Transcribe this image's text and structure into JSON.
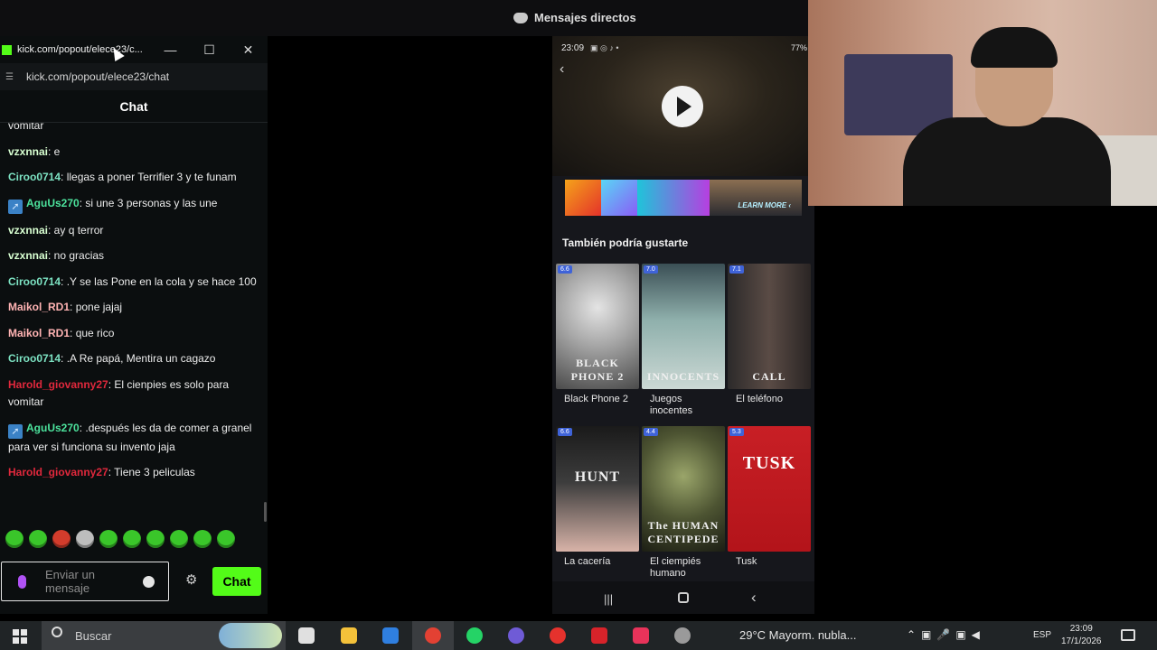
{
  "discord": {
    "title": "Mensajes directos"
  },
  "kick": {
    "window_title": "kick.com/popout/elece23/c...",
    "url": "kick.com/popout/elece23/chat",
    "chat_header": "Chat",
    "messages": [
      {
        "user": "",
        "text": "vomitar",
        "color": "#ffffff",
        "badge": false
      },
      {
        "user": "vzxnnai",
        "text": ": e",
        "color": "#d8ffd1",
        "badge": false
      },
      {
        "user": "Ciroo0714",
        "text": ": llegas a poner Terrifier 3 y te funam",
        "color": "#7de3c3",
        "badge": false
      },
      {
        "user": "AguUs270",
        "text": ": si une 3 personas y las une",
        "color": "#4ce29c",
        "badge": true
      },
      {
        "user": "vzxnnai",
        "text": ": ay q terror",
        "color": "#d8ffd1",
        "badge": false
      },
      {
        "user": "vzxnnai",
        "text": ": no gracias",
        "color": "#d8ffd1",
        "badge": false
      },
      {
        "user": "Ciroo0714",
        "text": ": .Y se las Pone en la cola y se hace 100",
        "color": "#7de3c3",
        "badge": false
      },
      {
        "user": "Maikol_RD1",
        "text": ": pone jajaj",
        "color": "#ffb3b3",
        "badge": false
      },
      {
        "user": "Maikol_RD1",
        "text": ": que rico",
        "color": "#ffb3b3",
        "badge": false
      },
      {
        "user": "Ciroo0714",
        "text": ": .A Re papá, Mentira un cagazo",
        "color": "#7de3c3",
        "badge": false
      },
      {
        "user": "Harold_giovanny27",
        "text": ": El cienpies es solo para vomitar",
        "color": "#e0283c",
        "badge": false
      },
      {
        "user": "AguUs270",
        "text": ": .después les da de comer a granel para ver si funciona su invento jaja",
        "color": "#4ce29c",
        "badge": true
      },
      {
        "user": "Harold_giovanny27",
        "text": ": Tiene 3 peliculas",
        "color": "#e0283c",
        "badge": false
      }
    ],
    "input_placeholder": "Enviar un mensaje",
    "send_button": "Chat",
    "accent": "#53fc18"
  },
  "phone": {
    "time": "23:09",
    "status_icons": "▣ ◎ ♪ •",
    "battery": "77%",
    "ad_cta": "LEARN MORE ‹",
    "section_title": "También podría gustarte",
    "movies": [
      {
        "title": "Black Phone 2",
        "rating": "6.6",
        "poster_text": "BLACK PHONE 2"
      },
      {
        "title": "Juegos inocentes",
        "rating": "7.0",
        "poster_text": "INNOCENTS"
      },
      {
        "title": "El teléfono",
        "rating": "7.1",
        "poster_text": "CALL"
      },
      {
        "title": "La cacería",
        "rating": "6.6",
        "poster_text": "HUNT"
      },
      {
        "title": "El ciempiés humano",
        "rating": "4.4",
        "poster_text": "The HUMAN CENTIPEDE"
      },
      {
        "title": "Tusk",
        "rating": "5.3",
        "poster_text": "TUSK"
      }
    ]
  },
  "taskbar": {
    "search_placeholder": "Buscar",
    "weather": "29°C  Mayorm. nubla...",
    "language": "ESP",
    "time": "23:09",
    "date": "17/1/2026"
  }
}
